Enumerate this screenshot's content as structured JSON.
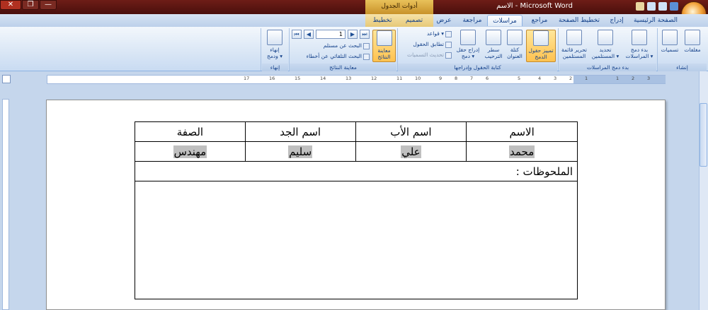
{
  "window": {
    "title": "الاسم - Microsoft Word",
    "context_tab_group": "أدوات الجدول",
    "close_glyph": "✕",
    "restore_glyph": "❐",
    "minimize_glyph": "—"
  },
  "tabs": [
    "الصفحة الرئيسية",
    "إدراج",
    "تخطيط الصفحة",
    "مراجع",
    "مراسلات",
    "مراجعة",
    "عرض",
    "تصميم",
    "تخطيط"
  ],
  "active_tab": "مراسلات",
  "ribbon": {
    "groups": {
      "create": "إنشاء",
      "start_merge": "بدء دمج المراسلات",
      "write_insert": "كتابة الحقول وإدراجها",
      "preview": "معاينة النتائج",
      "finish": "إنهاء"
    },
    "buttons": {
      "envelopes": "مغلفات",
      "labels": "تسميات",
      "start_merge_1": "بدء دمج",
      "start_merge_2": "المراسلات ▾",
      "select_1": "تحديد",
      "select_2": "المستلمين ▾",
      "edit_list_1": "تحرير قائمة",
      "edit_list_2": "المستلمين",
      "highlight_1": "تمييز حقول",
      "highlight_2": "الدمج",
      "address_1": "كتلة",
      "address_2": "العنوان",
      "greeting_1": "سطر",
      "greeting_2": "الترحيب",
      "insert_field_1": "إدراج حقل",
      "insert_field_2": "دمج ▾",
      "rules": "قواعد ▾",
      "match_fields": "تطابق الحقول",
      "update_labels": "تحديث التسميات",
      "preview_1": "معاينة",
      "preview_2": "النتائج",
      "find_recipient": "البحث عن مستلم",
      "auto_check": "البحث التلقائي عن أخطاء",
      "record_number": "1",
      "finish_1": "إنهاء",
      "finish_2": "ودمج ▾"
    }
  },
  "ruler": {
    "numbers": [
      "3",
      "2",
      "1",
      "1",
      "2",
      "3",
      "4",
      "5",
      "6",
      "7",
      "8",
      "9",
      "10",
      "11",
      "12",
      "13",
      "14",
      "15",
      "16",
      "17"
    ]
  },
  "document": {
    "headers": [
      "الاسم",
      "اسم الأب",
      "اسم الجد",
      "الصفة"
    ],
    "row": [
      "محمد",
      "علي",
      "سليم",
      "مهندس"
    ],
    "notes_label": "الملحوظات :"
  }
}
